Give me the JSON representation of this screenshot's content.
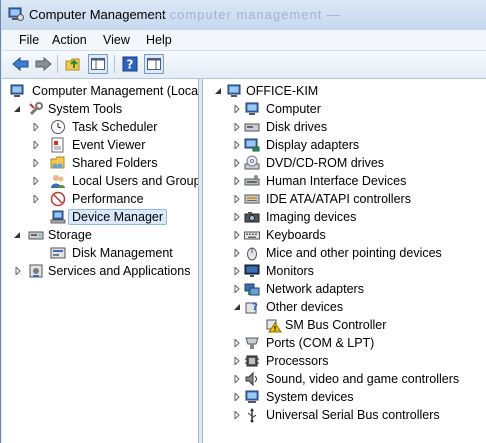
{
  "window": {
    "title": "Computer Management",
    "ghost_title": "— computer management —"
  },
  "menu": {
    "file": "File",
    "action": "Action",
    "view": "View",
    "help": "Help"
  },
  "toolbar": {
    "items": [
      "back-icon",
      "forward-icon",
      "up-folder-icon",
      "show-hide-tree-icon",
      "help-icon",
      "properties-pane-icon"
    ]
  },
  "left_tree": {
    "root": "Computer Management (Local",
    "system_tools": "System Tools",
    "task_scheduler": "Task Scheduler",
    "event_viewer": "Event Viewer",
    "shared_folders": "Shared Folders",
    "local_users": "Local Users and Groups",
    "performance": "Performance",
    "device_manager": "Device Manager",
    "storage": "Storage",
    "disk_management": "Disk Management",
    "services": "Services and Applications"
  },
  "right_tree": {
    "root": "OFFICE-KIM",
    "computer": "Computer",
    "disk_drives": "Disk drives",
    "display_adapters": "Display adapters",
    "dvd": "DVD/CD-ROM drives",
    "hid": "Human Interface Devices",
    "ide": "IDE ATA/ATAPI controllers",
    "imaging": "Imaging devices",
    "keyboards": "Keyboards",
    "mice": "Mice and other pointing devices",
    "monitors": "Monitors",
    "network": "Network adapters",
    "other": "Other devices",
    "smbus": "SM Bus Controller",
    "ports": "Ports (COM & LPT)",
    "processors": "Processors",
    "sound": "Sound, video and game controllers",
    "system_devices": "System devices",
    "usb": "Universal Serial Bus controllers"
  },
  "colors": {
    "selection": "#d9e8fb",
    "accent": "#3a6fc7",
    "warning": "#f2c200"
  }
}
